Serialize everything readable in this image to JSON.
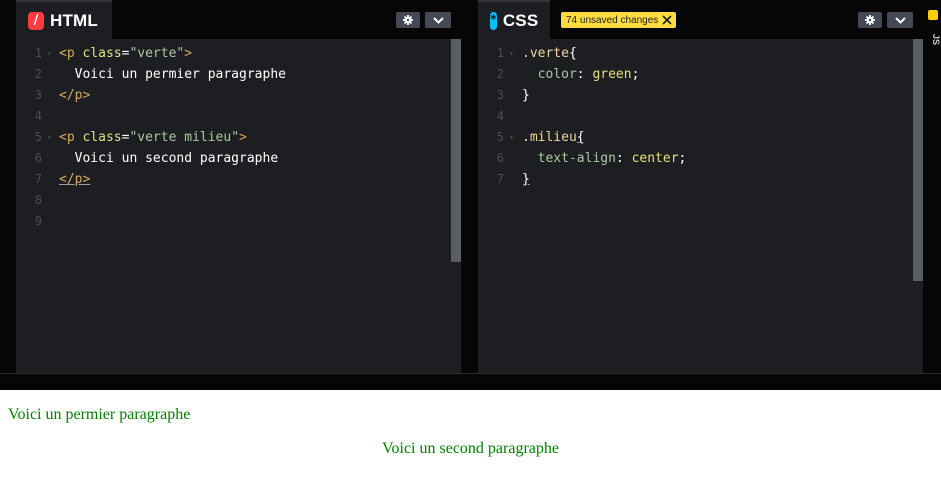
{
  "html_editor": {
    "title": "HTML",
    "icon": "html-slash-icon",
    "lines": [
      {
        "num": "1",
        "fold": true,
        "parts": [
          {
            "t": "<p ",
            "c": "c-tag"
          },
          {
            "t": "class",
            "c": "c-attr"
          },
          {
            "t": "=",
            "c": "c-punc"
          },
          {
            "t": "\"verte\"",
            "c": "c-str"
          },
          {
            "t": ">",
            "c": "c-tag"
          }
        ]
      },
      {
        "num": "2",
        "fold": false,
        "parts": [
          {
            "t": "  Voici un permier paragraphe",
            "c": "c-text"
          }
        ]
      },
      {
        "num": "3",
        "fold": false,
        "parts": [
          {
            "t": "</p>",
            "c": "c-tag"
          }
        ]
      },
      {
        "num": "4",
        "fold": false,
        "parts": []
      },
      {
        "num": "5",
        "fold": true,
        "parts": [
          {
            "t": "<p ",
            "c": "c-tag"
          },
          {
            "t": "class",
            "c": "c-attr"
          },
          {
            "t": "=",
            "c": "c-punc"
          },
          {
            "t": "\"verte milieu\"",
            "c": "c-str"
          },
          {
            "t": ">",
            "c": "c-tag"
          }
        ]
      },
      {
        "num": "6",
        "fold": false,
        "parts": [
          {
            "t": "  Voici un second paragraphe",
            "c": "c-text"
          }
        ]
      },
      {
        "num": "7",
        "fold": false,
        "parts": [
          {
            "t": "</p>",
            "c": "c-tag u"
          }
        ]
      },
      {
        "num": "8",
        "fold": false,
        "parts": []
      },
      {
        "num": "9",
        "fold": false,
        "parts": []
      }
    ]
  },
  "css_editor": {
    "title": "CSS",
    "icon": "css-asterisk-icon",
    "unsaved_badge": "74 unsaved changes",
    "lines": [
      {
        "num": "1",
        "fold": true,
        "parts": [
          {
            "t": ".verte",
            "c": "c-sel"
          },
          {
            "t": "{",
            "c": "c-punc"
          }
        ]
      },
      {
        "num": "2",
        "fold": false,
        "parts": [
          {
            "t": "  color",
            "c": "c-prop"
          },
          {
            "t": ": ",
            "c": "c-punc"
          },
          {
            "t": "green",
            "c": "c-val"
          },
          {
            "t": ";",
            "c": "c-punc"
          }
        ]
      },
      {
        "num": "3",
        "fold": false,
        "parts": [
          {
            "t": "}",
            "c": "c-punc"
          }
        ]
      },
      {
        "num": "4",
        "fold": false,
        "parts": []
      },
      {
        "num": "5",
        "fold": true,
        "parts": [
          {
            "t": ".milieu",
            "c": "c-sel"
          },
          {
            "t": "{",
            "c": "c-punc u"
          }
        ]
      },
      {
        "num": "6",
        "fold": false,
        "parts": [
          {
            "t": "  text-align",
            "c": "c-prop"
          },
          {
            "t": ": ",
            "c": "c-punc"
          },
          {
            "t": "center",
            "c": "c-val"
          },
          {
            "t": ";",
            "c": "c-punc"
          }
        ]
      },
      {
        "num": "7",
        "fold": false,
        "parts": [
          {
            "t": "}",
            "c": "c-punc u"
          }
        ]
      }
    ]
  },
  "js_strip": {
    "label": "JS"
  },
  "preview": {
    "p1": "Voici un permier paragraphe",
    "p2": "Voici un second paragraphe",
    "text_color": "#008000"
  },
  "colors": {
    "html_accent": "#ff3c41",
    "css_accent": "#0ebeff",
    "badge": "#ffdd40",
    "editor_bg": "#1d1e22"
  }
}
